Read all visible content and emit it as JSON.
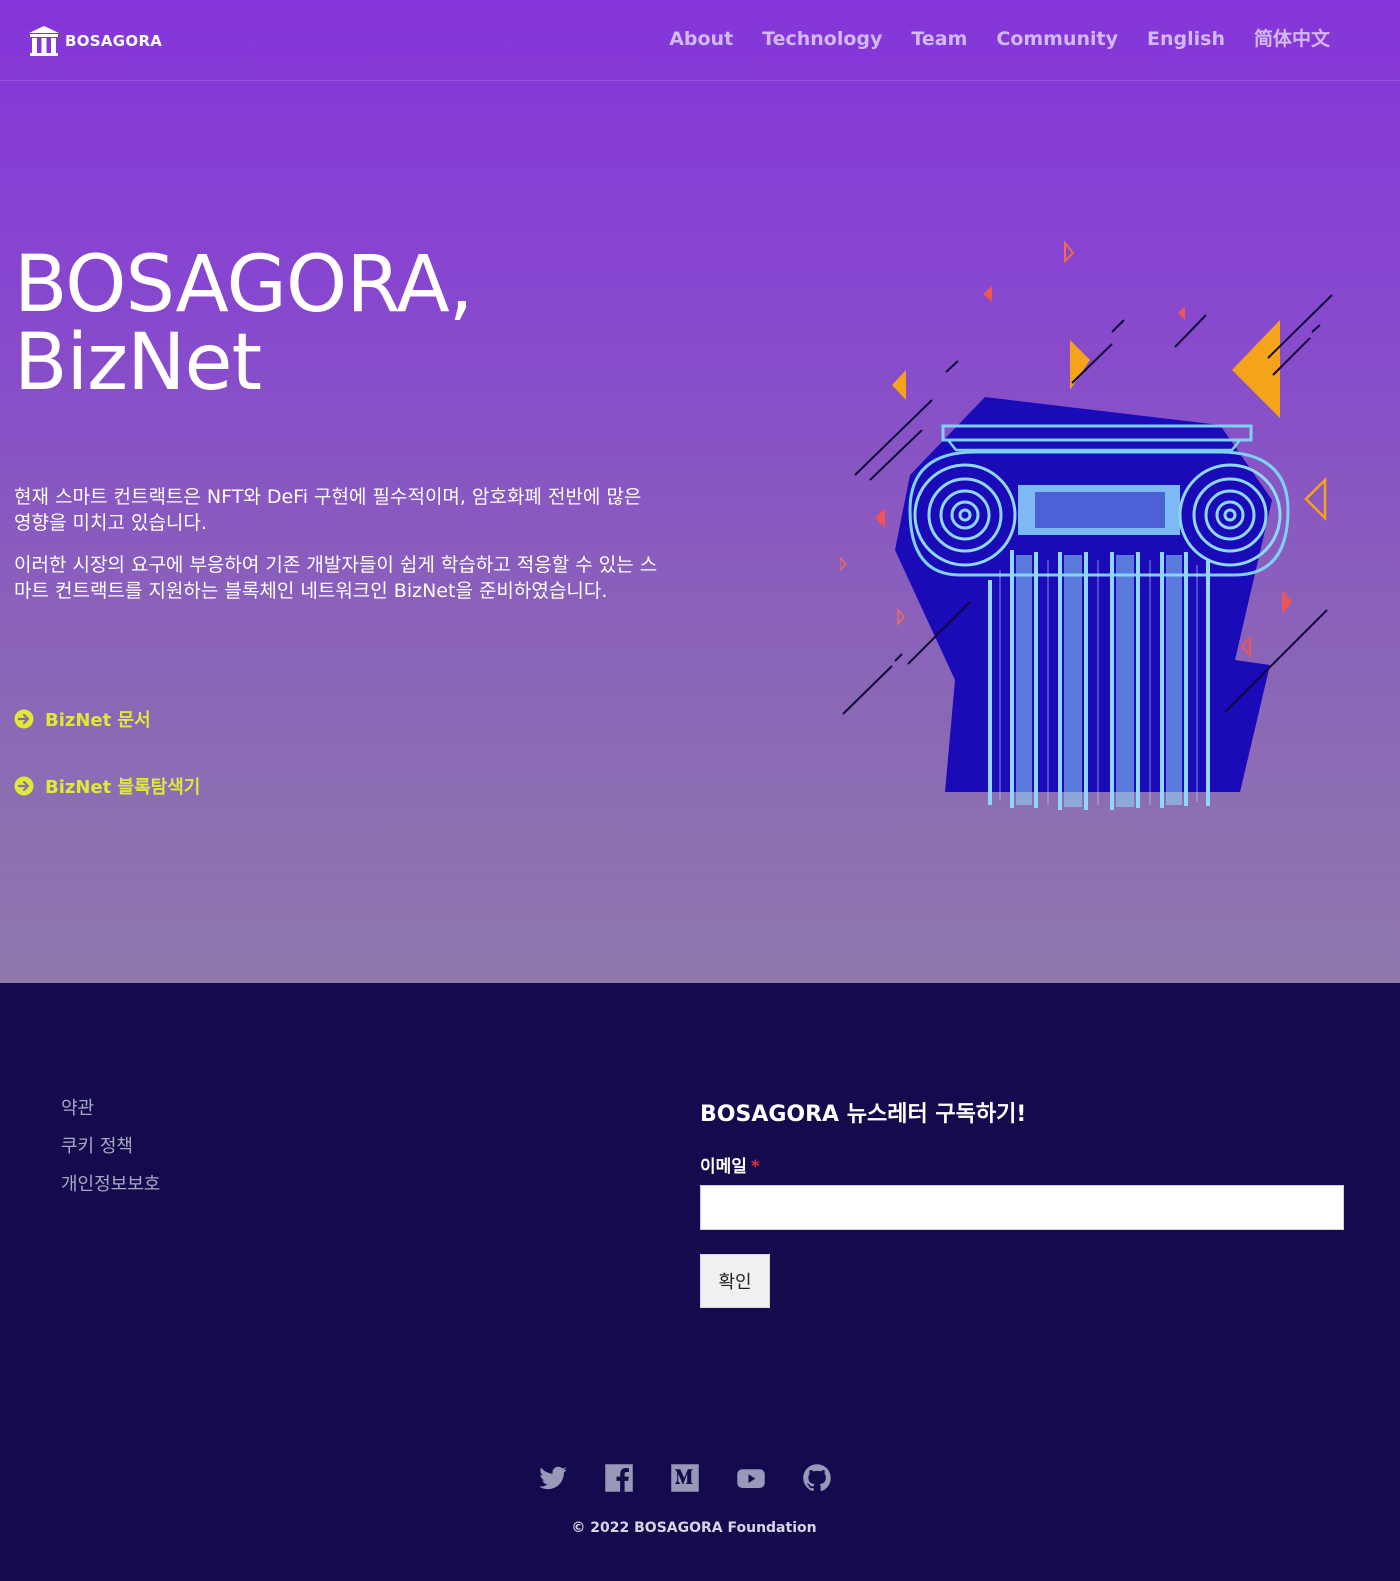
{
  "brand": {
    "name": "BOSAGORA"
  },
  "nav": {
    "about": "About",
    "technology": "Technology",
    "team": "Team",
    "community": "Community",
    "english": "English",
    "chinese": "简体中文"
  },
  "hero": {
    "title_line1": "BOSAGORA,",
    "title_line2": "BizNet",
    "paragraph1": "현재 스마트 컨트랙트은 NFT와 DeFi 구현에 필수적이며, 암호화폐 전반에 많은 영향을 미치고 있습니다.",
    "paragraph2": "이러한 시장의 요구에 부응하여 기존 개발자들이 쉽게 학습하고 적응할 수 있는 스마트 컨트랙트를 지원하는 블록체인 네트워크인 BizNet을 준비하였습니다.",
    "link_docs": "BizNet 문서",
    "link_explorer": "BizNet 블록탐색기"
  },
  "footer": {
    "links": {
      "terms": "약관",
      "cookies": "쿠키 정책",
      "privacy": "개인정보보호"
    },
    "newsletter": {
      "title": "BOSAGORA 뉴스레터 구독하기!",
      "email_label": "이메일",
      "required_mark": "*",
      "email_value": "",
      "submit_label": "확인"
    },
    "social_icons": [
      "twitter-icon",
      "facebook-icon",
      "medium-icon",
      "youtube-icon",
      "github-icon"
    ],
    "copyright": "© 2022 BOSAGORA Foundation"
  },
  "colors": {
    "hero_top": "#8535d9",
    "hero_bottom": "#8f79ad",
    "footer_bg": "#130b4d",
    "link_accent": "#e0e936",
    "nav_text": "#d2b8f4"
  }
}
